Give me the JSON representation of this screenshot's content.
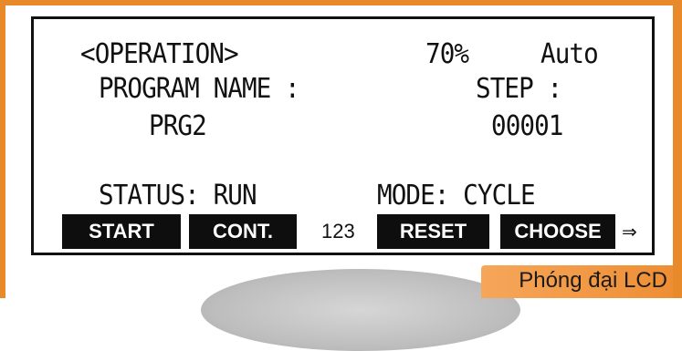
{
  "header": {
    "operation_label": "<OPERATION>",
    "speed": "70%",
    "run_mode": "Auto"
  },
  "program": {
    "name_label": "PROGRAM NAME :",
    "name_value": "PRG2",
    "step_label": "STEP :",
    "step_value": "00001"
  },
  "status": {
    "status_text": "STATUS: RUN",
    "mode_text": "MODE: CYCLE"
  },
  "softkeys": {
    "start": "START",
    "cont": "CONT.",
    "number": "123",
    "reset": "RESET",
    "choose": "CHOOSE",
    "next": "⇒"
  },
  "caption": "Phóng đại LCD",
  "colors": {
    "frame": "#e98a2a",
    "caption_bar": "#ee8e34",
    "softkey_bg": "#0e0e0e",
    "softkey_text": "#ffffff"
  }
}
